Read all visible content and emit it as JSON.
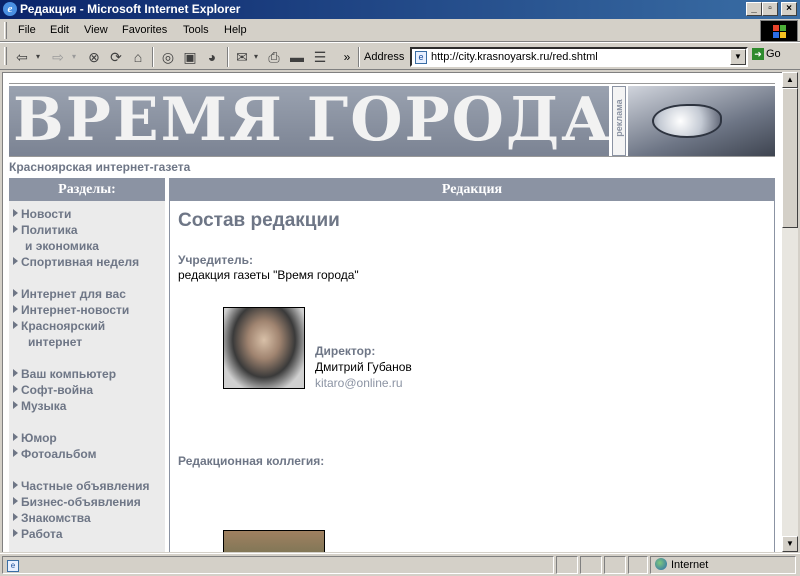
{
  "window": {
    "title": "Редакция - Microsoft Internet Explorer",
    "buttons": [
      "_",
      "▫",
      "×"
    ]
  },
  "menu": {
    "items": [
      "File",
      "Edit",
      "View",
      "Favorites",
      "Tools",
      "Help"
    ]
  },
  "toolbar": {
    "address_label": "Address",
    "url": "http://city.krasnoyarsk.ru/red.shtml",
    "go_label": "Go",
    "overflow": "»"
  },
  "site": {
    "banner_title": "ВРЕМЯ ГОРОДА",
    "ad_label": "реклама",
    "subtitle": "Красноярская интернет-газета",
    "left_heading": "Разделы:",
    "nav": [
      {
        "label": "Новости"
      },
      {
        "label": "Политика",
        "cont": "и экономика"
      },
      {
        "label": "Спортивная неделя"
      },
      {
        "label": "Интернет для вас"
      },
      {
        "label": "Интернет-новости"
      },
      {
        "label": "Красноярский",
        "cont": "интернет"
      },
      {
        "label": "Ваш компьютер"
      },
      {
        "label": "Софт-война"
      },
      {
        "label": "Музыка"
      },
      {
        "label": "Юмор"
      },
      {
        "label": "Фотоальбом"
      },
      {
        "label": "Частные объявления"
      },
      {
        "label": "Бизнес-объявления"
      },
      {
        "label": "Знакомства"
      },
      {
        "label": "Работа"
      }
    ],
    "main_heading": "Редакция",
    "page_title": "Состав редакции",
    "founder_label": "Учредитель:",
    "founder_value": "редакция газеты \"Время города\"",
    "director_label": "Директор:",
    "director_name": "Дмитрий Губанов",
    "director_email": "kitaro@online.ru",
    "board_label": "Редакционная коллегия:"
  },
  "status": {
    "zone": "Internet"
  }
}
